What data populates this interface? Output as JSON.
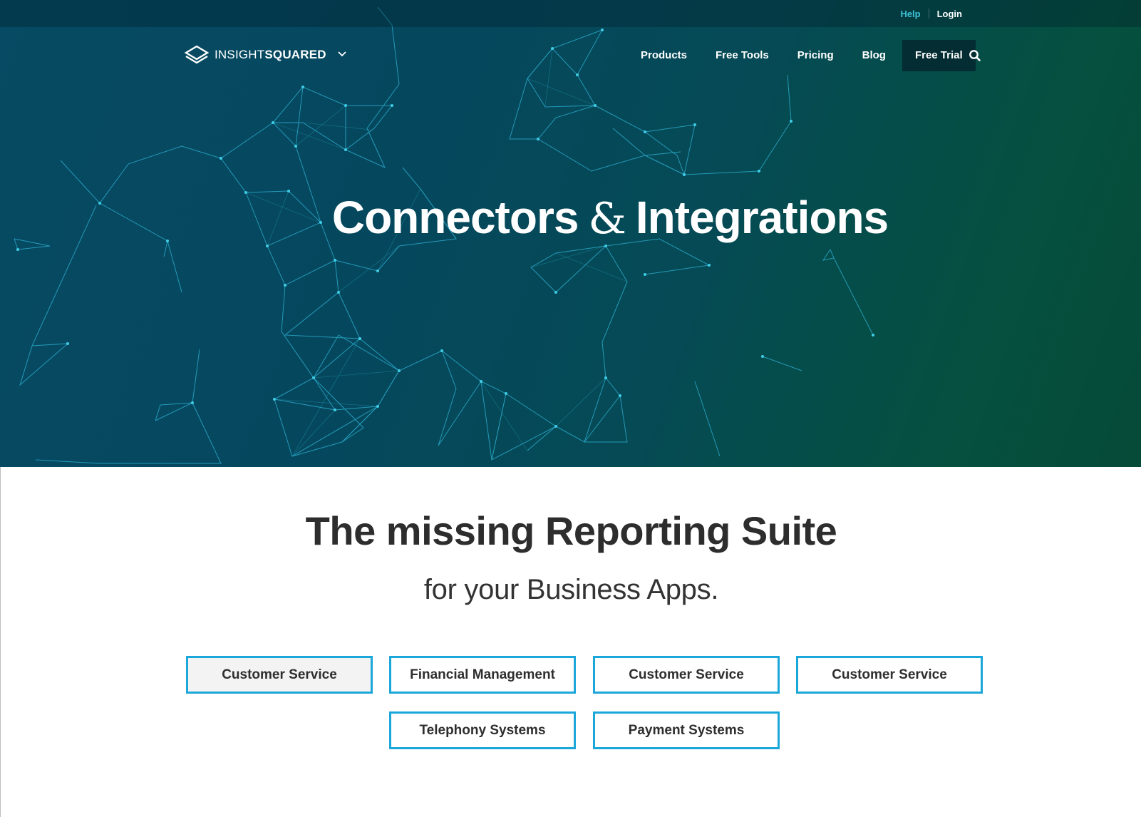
{
  "utility_nav": {
    "help_label": "Help",
    "login_label": "Login"
  },
  "header": {
    "logo_text_light": "INSIGHT",
    "logo_text_bold": "SQUARED",
    "nav_items": [
      {
        "label": "Products"
      },
      {
        "label": "Free Tools"
      },
      {
        "label": "Pricing"
      },
      {
        "label": "Blog"
      }
    ],
    "cta_label": "Free Trial"
  },
  "hero": {
    "title_part1": "Connectors",
    "title_amp": "&",
    "title_part2": "Integrations"
  },
  "main": {
    "heading": "The missing Reporting Suite",
    "subheading": "for your Business Apps.",
    "categories": [
      {
        "label": "Customer Service",
        "active": true
      },
      {
        "label": "Financial Management",
        "active": false
      },
      {
        "label": "Customer Service",
        "active": false
      },
      {
        "label": "Customer Service",
        "active": false
      },
      {
        "label": "Telephony Systems",
        "active": false
      },
      {
        "label": "Payment Systems",
        "active": false
      }
    ]
  },
  "colors": {
    "hero_start": "#064a63",
    "hero_end": "#064a38",
    "accent": "#1ba7d9",
    "network_line": "#2fb4d6",
    "help_link": "#3fc3d6",
    "cta_bg": "#032d33"
  }
}
